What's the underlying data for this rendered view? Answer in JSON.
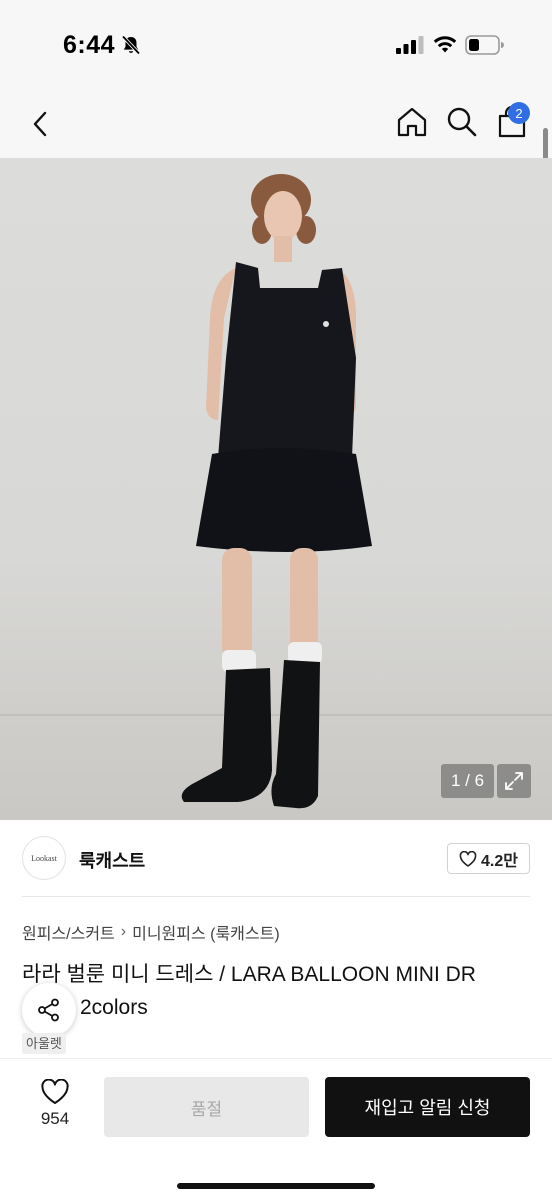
{
  "status_bar": {
    "time": "6:44",
    "icons": [
      "bell-slash-icon",
      "signal-icon",
      "wifi-icon",
      "battery-icon"
    ]
  },
  "nav": {
    "icons": [
      "chevron-left-icon",
      "home-icon",
      "search-icon",
      "bag-icon"
    ],
    "cart_badge": "2"
  },
  "gallery": {
    "counter": "1 / 6",
    "expand_icon": "expand-icon"
  },
  "seller": {
    "logo_text": "Lookast",
    "name": "룩캐스트",
    "likes": "4.2만"
  },
  "product": {
    "breadcrumb": [
      "원피스/스커트",
      "미니원피스 (룩캐스트)"
    ],
    "title_line1": "라라 벌룬 미니 드레스 / LARA BALLOON MINI DR",
    "title_line2_visible": "2colors",
    "brand_tag": "아울렛"
  },
  "bottom_bar": {
    "wishlist_count": "954",
    "soldout_label": "품절",
    "restock_label": "재입고 알림 신청"
  },
  "colors": {
    "accent_badge": "#2f6fe3",
    "primary_button": "#111111",
    "disabled_button": "#e8e8e8"
  }
}
